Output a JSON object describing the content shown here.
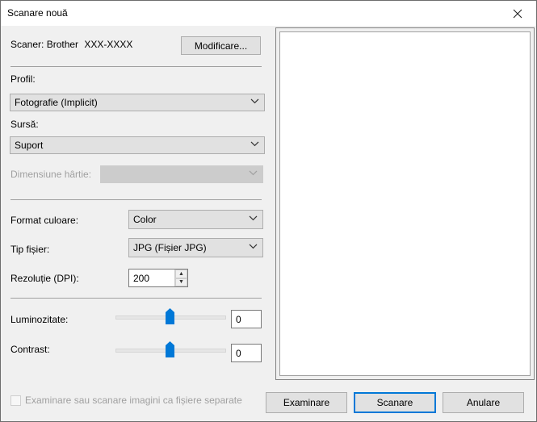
{
  "window": {
    "title": "Scanare nouă"
  },
  "scanner": {
    "label": "Scaner: Brother",
    "model": "XXX-XXXX",
    "change_button": "Modificare..."
  },
  "profile": {
    "label": "Profil:",
    "value": "Fotografie (Implicit)"
  },
  "source": {
    "label": "Sursă:",
    "value": "Suport"
  },
  "paper_size": {
    "label": "Dimensiune hârtie:",
    "value": ""
  },
  "color_format": {
    "label": "Format culoare:",
    "value": "Color"
  },
  "file_type": {
    "label": "Tip fișier:",
    "value": "JPG (Fișier JPG)"
  },
  "resolution": {
    "label": "Rezoluție (DPI):",
    "value": "200"
  },
  "brightness": {
    "label": "Luminozitate:",
    "value": "0",
    "slider_level": 0
  },
  "contrast": {
    "label": "Contrast:",
    "value": "0",
    "slider_level": 0
  },
  "separate_files": {
    "label": "Examinare sau scanare imagini ca fișiere separate",
    "checked": false
  },
  "buttons": {
    "preview": "Examinare",
    "scan": "Scanare",
    "cancel": "Anulare"
  },
  "colors": {
    "accent": "#0078d7",
    "slider_thumb": "#0078d7"
  },
  "icons": {
    "close": "close-icon",
    "dropdown": "chevron-down-icon",
    "spin_up": "spin-up-icon",
    "spin_down": "spin-down-icon"
  }
}
